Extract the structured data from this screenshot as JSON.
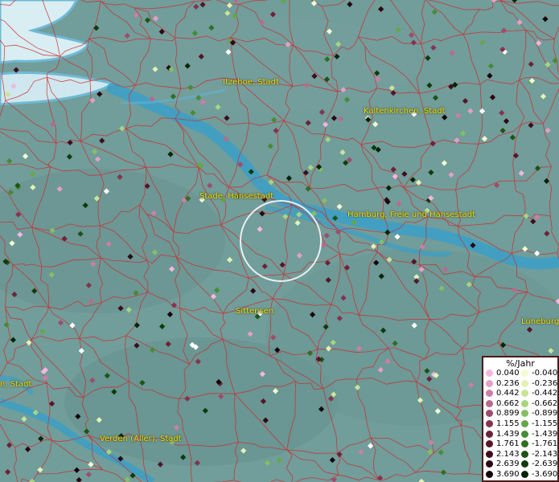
{
  "map": {
    "towns": [
      {
        "name": "Itzehoe, Stadt"
      },
      {
        "name": "Kaltenkirchen, Stadt"
      },
      {
        "name": "Stade, Hansestadt"
      },
      {
        "name": "Hamburg, Freie und Hansestadt"
      },
      {
        "name": "Sittensen"
      },
      {
        "name": "Lüneburg"
      },
      {
        "name": "n, Stadt"
      },
      {
        "name": "Verden (Aller), Stadt"
      }
    ],
    "colors": {
      "background": "#6f9b98",
      "water": "#3aa0c8",
      "borders": "#d0292b",
      "labels": "#f2e600",
      "selection_ring": "#ffffff"
    }
  },
  "legend": {
    "title": "%/Jahr",
    "positive": [
      {
        "value": "0.040",
        "color": "#f3b7de"
      },
      {
        "value": "0.236",
        "color": "#e2a0c6"
      },
      {
        "value": "0.442",
        "color": "#cd7ea6"
      },
      {
        "value": "0.662",
        "color": "#b96a8d"
      },
      {
        "value": "0.899",
        "color": "#9e4d6d"
      },
      {
        "value": "1.155",
        "color": "#86334f"
      },
      {
        "value": "1.439",
        "color": "#6e2238"
      },
      {
        "value": "1.761",
        "color": "#551528"
      },
      {
        "value": "2.143",
        "color": "#3e0d1b"
      },
      {
        "value": "2.639",
        "color": "#2a0711"
      },
      {
        "value": "3.690",
        "color": "#16030a"
      }
    ],
    "negative": [
      {
        "value": "-0.040",
        "color": "#f4fad2"
      },
      {
        "value": "-0.236",
        "color": "#e2f2b5"
      },
      {
        "value": "-0.442",
        "color": "#c7e59a"
      },
      {
        "value": "-0.662",
        "color": "#a8d47f"
      },
      {
        "value": "-0.899",
        "color": "#86bf63"
      },
      {
        "value": "-1.155",
        "color": "#65a74a"
      },
      {
        "value": "-1.439",
        "color": "#488b35"
      },
      {
        "value": "-1.761",
        "color": "#2f6f24"
      },
      {
        "value": "-2.143",
        "color": "#1d5416"
      },
      {
        "value": "-2.639",
        "color": "#0f3b0c"
      },
      {
        "value": "-3.690",
        "color": "#062405"
      }
    ]
  }
}
